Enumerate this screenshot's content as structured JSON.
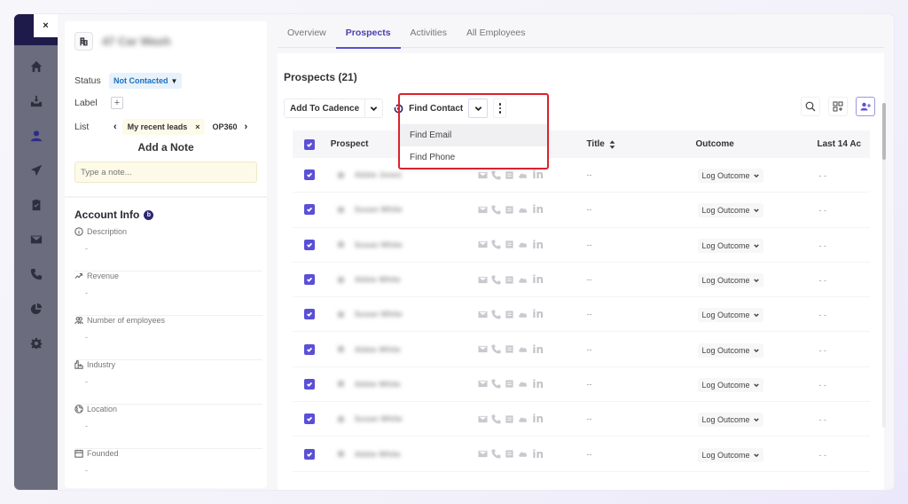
{
  "window": {
    "close_label": "×"
  },
  "nav_rail": {
    "items": [
      {
        "name": "home",
        "icon": "home-icon"
      },
      {
        "name": "inbox",
        "icon": "inbox-icon"
      },
      {
        "name": "prospects",
        "icon": "user-icon",
        "active": true
      },
      {
        "name": "cadences",
        "icon": "send-icon"
      },
      {
        "name": "tasks",
        "icon": "clipboard-icon"
      },
      {
        "name": "email",
        "icon": "mail-icon"
      },
      {
        "name": "calls",
        "icon": "phone-icon"
      },
      {
        "name": "reports",
        "icon": "pie-chart-icon"
      },
      {
        "name": "settings",
        "icon": "gear-icon"
      }
    ]
  },
  "account": {
    "name": "47 Car Wash",
    "status_label": "Status",
    "status_value": "Not Contacted",
    "label_label": "Label",
    "label_add": "+",
    "list_label": "List",
    "list_chips": [
      "My recent leads",
      "OP360"
    ],
    "list_chip_remove": "×",
    "note_title": "Add a Note",
    "note_placeholder": "Type a note...",
    "info_title": "Account Info",
    "info_badge": "b",
    "info_fields": [
      {
        "label": "Description",
        "value": "-",
        "icon": "info-circle-icon"
      },
      {
        "label": "Revenue",
        "value": "-",
        "icon": "trend-up-icon"
      },
      {
        "label": "Number of employees",
        "value": "-",
        "icon": "users-icon"
      },
      {
        "label": "Industry",
        "value": "-",
        "icon": "factory-icon"
      },
      {
        "label": "Location",
        "value": "-",
        "icon": "globe-icon"
      },
      {
        "label": "Founded",
        "value": "-",
        "icon": "calendar-icon"
      }
    ]
  },
  "tabs": [
    {
      "label": "Overview",
      "active": false
    },
    {
      "label": "Prospects",
      "active": true
    },
    {
      "label": "Activities",
      "active": false
    },
    {
      "label": "All Employees",
      "active": false
    }
  ],
  "prospects": {
    "title": "Prospects (21)",
    "add_to_cadence": "Add To Cadence",
    "find_contact": "Find Contact",
    "dropdown_items": [
      "Find Email",
      "Find Phone"
    ],
    "columns": {
      "prospect": "Prospect",
      "title": "Title",
      "outcome": "Outcome",
      "last": "Last 14 Ac"
    },
    "rows": [
      {
        "name": "Abbie Jones",
        "initial": "A",
        "title": "--",
        "outcome": "Log Outcome",
        "last": "- -"
      },
      {
        "name": "Susan White",
        "initial": "S",
        "title": "--",
        "outcome": "Log Outcome",
        "last": "- -"
      },
      {
        "name": "Susan White",
        "initial": "S",
        "title": "--",
        "outcome": "Log Outcome",
        "last": "- -"
      },
      {
        "name": "Abbie White",
        "initial": "A",
        "title": "--",
        "outcome": "Log Outcome",
        "last": "- -"
      },
      {
        "name": "Susan White",
        "initial": "S",
        "title": "--",
        "outcome": "Log Outcome",
        "last": "- -"
      },
      {
        "name": "Abbie White",
        "initial": "A",
        "title": "--",
        "outcome": "Log Outcome",
        "last": "- -"
      },
      {
        "name": "Abbie White",
        "initial": "A",
        "title": "--",
        "outcome": "Log Outcome",
        "last": "- -"
      },
      {
        "name": "Susan White",
        "initial": "S",
        "title": "--",
        "outcome": "Log Outcome",
        "last": "- -"
      },
      {
        "name": "Abbie White",
        "initial": "A",
        "title": "--",
        "outcome": "Log Outcome",
        "last": "- -"
      }
    ]
  },
  "colors": {
    "accent": "#5b4fd6",
    "nav_rail": "#6b6c7e",
    "nav_top": "#1e1b4b",
    "highlight": "#d9232e",
    "status_pill_bg": "#e8f2fc",
    "status_pill_text": "#1d6fbf"
  }
}
